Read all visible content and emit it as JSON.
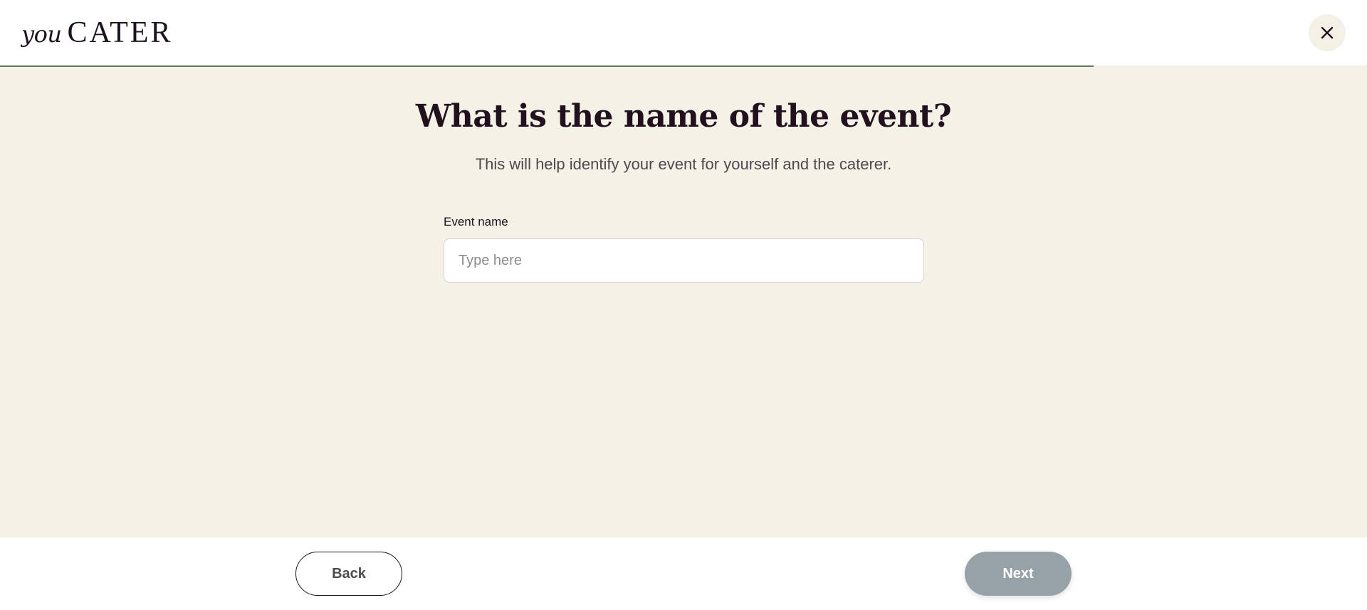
{
  "header": {
    "logo_you": "you",
    "logo_cater": "CATER",
    "close_icon": "close-icon",
    "progress_percent": 80,
    "progress_color": "#5a7a5a"
  },
  "main": {
    "title": "What is the name of the event?",
    "subtitle": "This will help identify your event for yourself and the caterer.",
    "field": {
      "label": "Event name",
      "value": "",
      "placeholder": "Type here"
    }
  },
  "footer": {
    "back_label": "Back",
    "next_label": "Next",
    "next_color": "#97a1a8"
  },
  "colors": {
    "background": "#f4f1e6",
    "heading": "#22101f",
    "accent": "#5a7a5a"
  }
}
